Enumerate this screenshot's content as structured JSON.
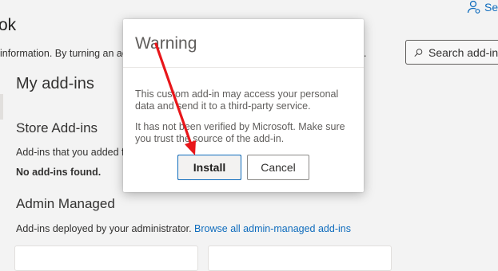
{
  "header": {
    "app_title": "ok",
    "settings_label": "Se",
    "info_text": "information. By turning an ac",
    "info_suffix": "."
  },
  "search": {
    "placeholder": "Search add-ins"
  },
  "sections": {
    "my_addins": "My add-ins",
    "store_title": "Store Add-ins",
    "store_desc": "Add-ins that you added f",
    "no_addins": "No add-ins found.",
    "admin_title": "Admin Managed",
    "admin_desc": "Add-ins deployed by your administrator.",
    "admin_link": "Browse all admin-managed add-ins"
  },
  "dialog": {
    "title": "Warning",
    "paragraph1": "This custom add-in may access your personal data and send it to a third-party service.",
    "paragraph2": "It has not been verified by Microsoft. Make sure you trust the source of the add-in.",
    "install_label": "Install",
    "cancel_label": "Cancel"
  },
  "colors": {
    "accent": "#0f6cbd",
    "annotation_arrow": "#e8161a",
    "page_background": "#f3f3f3"
  },
  "icons": {
    "settings": "person-gear-icon",
    "search": "search-icon"
  }
}
